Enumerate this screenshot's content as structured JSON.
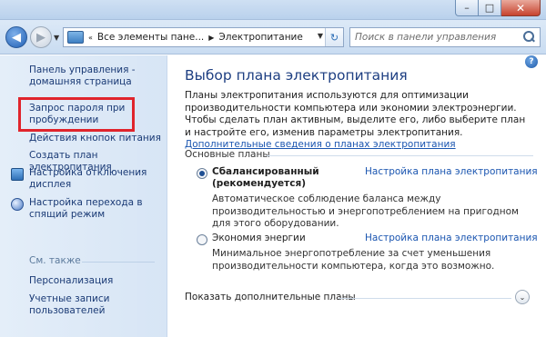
{
  "window": {
    "min_label": "–",
    "max_label": "□",
    "close_label": "✕"
  },
  "nav": {
    "back_label": "◀",
    "forward_label": "▶",
    "address": {
      "crumb1": "Все элементы пане...",
      "crumb2": "Электропитание",
      "sep": "▶"
    },
    "refresh_label": "↻",
    "search_placeholder": "Поиск в панели управления"
  },
  "sidebar": {
    "home_link_line1": "Панель управления -",
    "home_link_line2": "домашняя страница",
    "items": [
      {
        "label_line1": "Запрос пароля при",
        "label_line2": "пробуждении"
      },
      {
        "label_line1": "Действия кнопок питания"
      },
      {
        "label_line1": "Создать план электропитания"
      },
      {
        "label_line1": "Настройка отключения",
        "label_line2": "дисплея"
      },
      {
        "label_line1": "Настройка перехода в",
        "label_line2": "спящий режим"
      }
    ],
    "see_also": "См. также",
    "see_also_links": [
      {
        "label": "Персонализация"
      },
      {
        "label_line1": "Учетные записи",
        "label_line2": "пользователей"
      }
    ]
  },
  "main": {
    "help_label": "?",
    "title": "Выбор плана электропитания",
    "description": "Планы электропитания используются для оптимизации производительности компьютера или экономии электроэнергии. Чтобы сделать план активным, выделите его, либо выберите план и настройте его, изменив параметры электропитания. ",
    "more_link": "Дополнительные сведения о планах электропитания",
    "section_title": "Основные планы",
    "plans": [
      {
        "name_line1": "Сбалансированный",
        "name_line2": "(рекомендуется)",
        "setting_link": "Настройка плана электропитания",
        "description": "Автоматическое соблюдение баланса между производительностью и энергопотреблением на пригодном для этого оборудовании.",
        "selected": true
      },
      {
        "name_line1": "Экономия энергии",
        "setting_link": "Настройка плана электропитания",
        "description": "Минимальное энергопотребление за счет уменьшения производительности компьютера, когда это возможно.",
        "selected": false
      }
    ],
    "show_more": "Показать дополнительные планы",
    "chevron": "⌄"
  }
}
